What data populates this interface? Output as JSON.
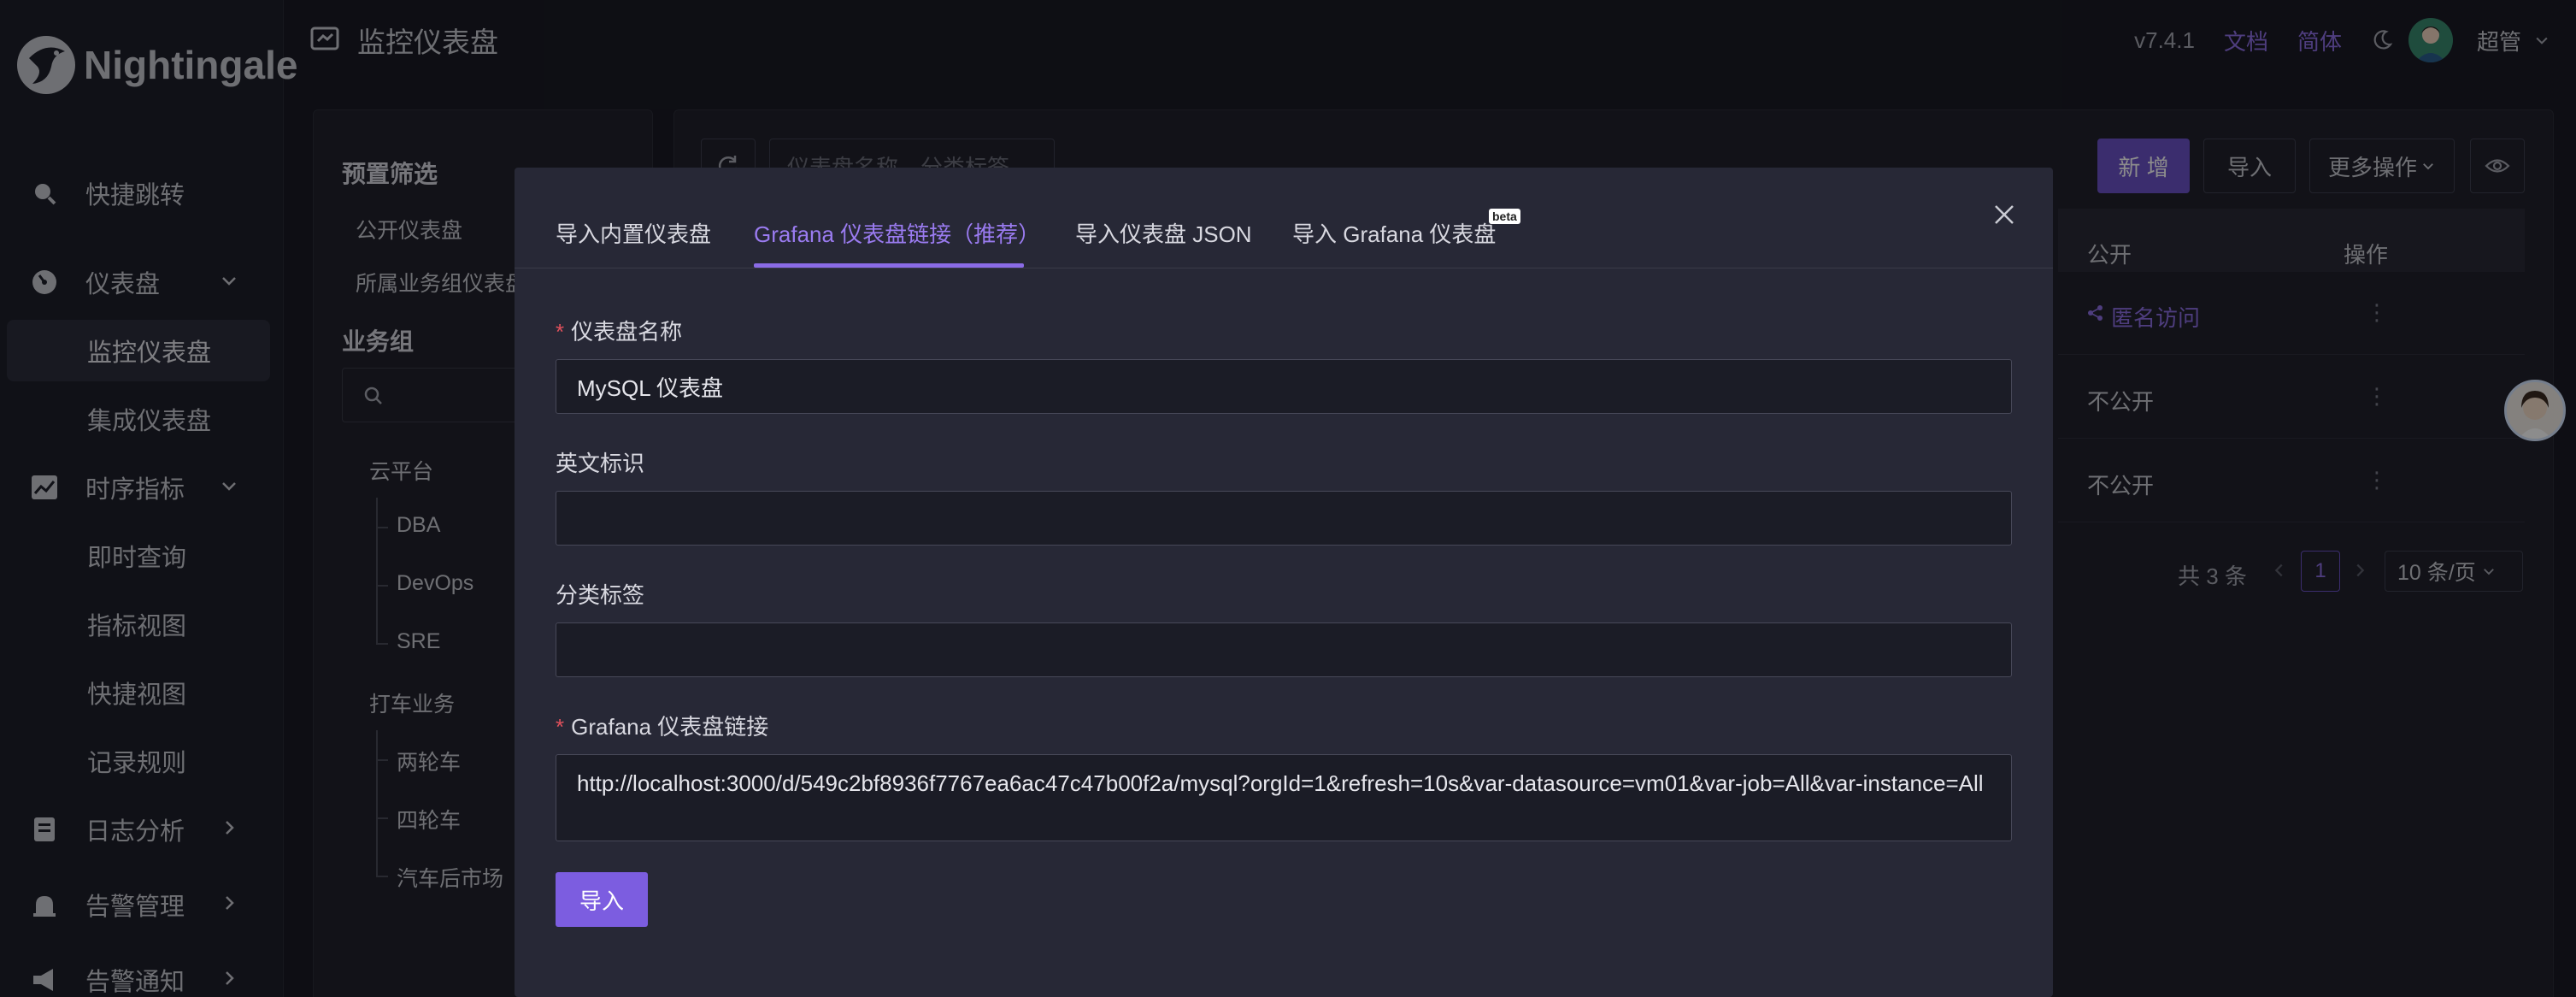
{
  "app": {
    "name": "Nightingale"
  },
  "header": {
    "title": "监控仪表盘",
    "version": "v7.4.1",
    "docs": "文档",
    "lang": "简体",
    "user": "超管"
  },
  "sidebar": {
    "items": [
      {
        "label": "快捷跳转",
        "icon": "search-icon"
      },
      {
        "label": "仪表盘",
        "icon": "dashboard-icon"
      },
      {
        "label": "监控仪表盘"
      },
      {
        "label": "集成仪表盘"
      },
      {
        "label": "时序指标",
        "icon": "line-chart-icon"
      },
      {
        "label": "即时查询"
      },
      {
        "label": "指标视图"
      },
      {
        "label": "快捷视图"
      },
      {
        "label": "记录规则"
      },
      {
        "label": "日志分析",
        "icon": "log-icon"
      },
      {
        "label": "告警管理",
        "icon": "alarm-icon"
      },
      {
        "label": "告警通知",
        "icon": "megaphone-icon"
      }
    ]
  },
  "filters": {
    "preset_title": "预置筛选",
    "public": "公开仪表盘",
    "my_groups": "所属业务组仪表盘",
    "bg_title": "业务组",
    "tree": [
      "云平台",
      "DBA",
      "DevOps",
      "SRE",
      "打车业务",
      "两轮车",
      "四轮车",
      "汽车后市场"
    ]
  },
  "toolbar": {
    "search_placeholder": "仪表盘名称、分类标签",
    "new": "新 增",
    "import": "导入",
    "more": "更多操作"
  },
  "table": {
    "headers": {
      "public": "公开",
      "actions": "操作"
    },
    "rows": [
      {
        "public": "匿名访问"
      },
      {
        "public": "不公开"
      },
      {
        "public": "不公开"
      }
    ],
    "pager": {
      "total": "共 3 条",
      "page": "1",
      "size": "10 条/页"
    }
  },
  "modal": {
    "tabs": [
      "导入内置仪表盘",
      "Grafana 仪表盘链接（推荐）",
      "导入仪表盘 JSON",
      "导入 Grafana 仪表盘"
    ],
    "beta": "beta",
    "fields": {
      "name_label": "仪表盘名称",
      "name_value": "MySQL 仪表盘",
      "ident_label": "英文标识",
      "ident_value": "",
      "tags_label": "分类标签",
      "tags_value": "",
      "url_label": "Grafana 仪表盘链接",
      "url_value": "http://localhost:3000/d/549c2bf8936f7767ea6ac47c47b00f2a/mysql?orgId=1&refresh=10s&var-datasource=vm01&var-job=All&var-instance=All"
    },
    "submit": "导入"
  },
  "colors": {
    "accent": "#8a6be6",
    "primary_button": "#6c53c8",
    "required": "#e0515c"
  }
}
